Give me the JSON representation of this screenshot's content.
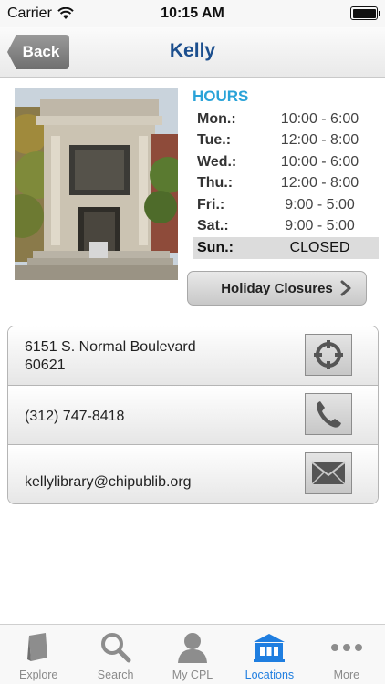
{
  "status_bar": {
    "carrier": "Carrier",
    "time": "10:15 AM"
  },
  "nav": {
    "back_label": "Back",
    "title": "Kelly"
  },
  "hours": {
    "heading": "HOURS",
    "rows": [
      {
        "day": "Mon.:",
        "time": "10:00 - 6:00"
      },
      {
        "day": "Tue.:",
        "time": "12:00 - 8:00"
      },
      {
        "day": "Wed.:",
        "time": "10:00 - 6:00"
      },
      {
        "day": "Thu.:",
        "time": "12:00 - 8:00"
      },
      {
        "day": "Fri.:",
        "time": "9:00 - 5:00"
      },
      {
        "day": "Sat.:",
        "time": "9:00 - 5:00"
      },
      {
        "day": "Sun.:",
        "time": "CLOSED"
      }
    ],
    "holiday_button": "Holiday Closures"
  },
  "contact": {
    "address_line1": "6151 S. Normal Boulevard",
    "address_line2": "60621",
    "phone": "(312) 747-8418",
    "email": "kellylibrary@chipublib.org",
    "icons": {
      "address": "crosshair-icon",
      "phone": "phone-icon",
      "email": "envelope-icon"
    }
  },
  "tabs": [
    {
      "label": "Explore",
      "icon": "book-icon"
    },
    {
      "label": "Search",
      "icon": "magnifier-icon"
    },
    {
      "label": "My CPL",
      "icon": "person-icon"
    },
    {
      "label": "Locations",
      "icon": "library-building-icon"
    },
    {
      "label": "More",
      "icon": "more-dots-icon"
    }
  ],
  "colors": {
    "title": "#1c4f8e",
    "hours_heading": "#2aa3d8",
    "active_tab": "#1f7ee0"
  }
}
